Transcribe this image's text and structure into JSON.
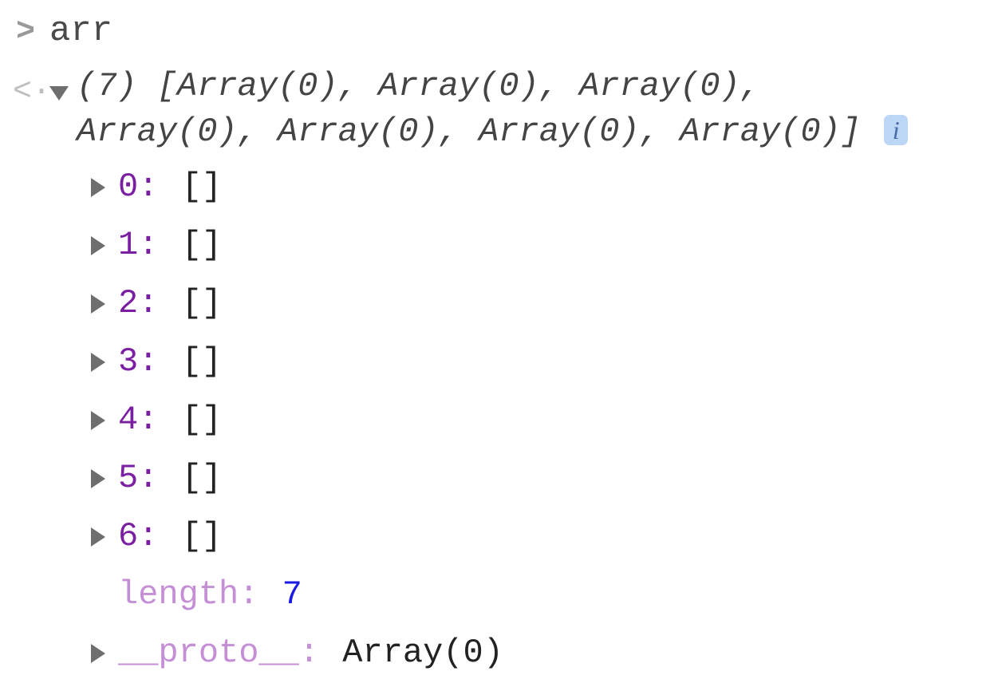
{
  "input": {
    "prompt": ">",
    "text": "arr"
  },
  "output": {
    "icon": "<·",
    "count_prefix": "(7)",
    "preview": "[Array(0), Array(0), Array(0), Array(0), Array(0), Array(0), Array(0)]",
    "info_badge": "i",
    "children": [
      {
        "key": "0",
        "val": "[]"
      },
      {
        "key": "1",
        "val": "[]"
      },
      {
        "key": "2",
        "val": "[]"
      },
      {
        "key": "3",
        "val": "[]"
      },
      {
        "key": "4",
        "val": "[]"
      },
      {
        "key": "5",
        "val": "[]"
      },
      {
        "key": "6",
        "val": "[]"
      }
    ],
    "length_label": "length",
    "length_value": "7",
    "proto_label": "__proto__",
    "proto_value": "Array(0)"
  }
}
